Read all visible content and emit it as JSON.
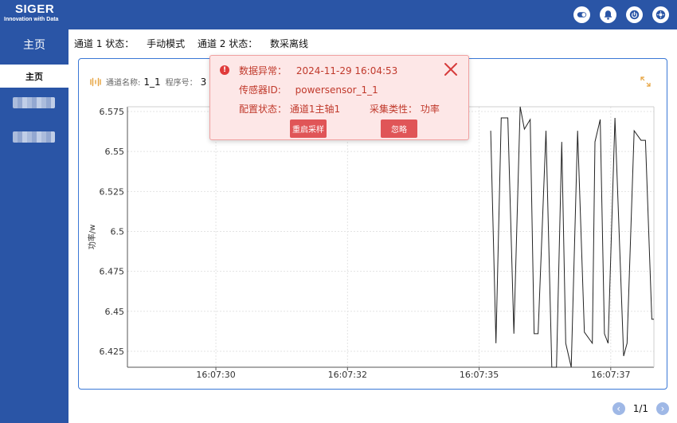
{
  "app": {
    "brand": "SIGER",
    "tagline": "Innovation with Data"
  },
  "header_icons": [
    "switch-icon",
    "bell-icon",
    "power-icon",
    "settings-icon"
  ],
  "sidebar": {
    "home_label": "主页",
    "active_label": "主页"
  },
  "status": {
    "ch1_label": "通道 1 状态：",
    "ch1_value": "手动模式",
    "ch2_label": "通道 2 状态：",
    "ch2_value": "数采离线"
  },
  "channel": {
    "name_label": "通道名称:",
    "name_value": "1_1",
    "program_label": "程序号：",
    "program_value": "3"
  },
  "alert": {
    "anomaly_label": "数据异常：",
    "anomaly_time": "2024-11-29 16:04:53",
    "sensor_label": "传感器ID:",
    "sensor_value": "powersensor_1_1",
    "config_label": "配置状态：",
    "config_value": "通道1主轴1",
    "type_label": "采集类性：",
    "type_value": "功率",
    "restart_label": "重启采样",
    "ignore_label": "忽略"
  },
  "pager": {
    "text": "1/1"
  },
  "colors": {
    "accent": "#2a55a6",
    "alert_text": "#c0392b",
    "alert_btn": "#e05557",
    "line": "#222222"
  },
  "chart_data": {
    "type": "line",
    "ylabel": "功率/w",
    "ylim": [
      6.415,
      6.578
    ],
    "xlim": [
      0,
      2000
    ],
    "yticks": [
      "6.575",
      "6.55",
      "6.525",
      "6.5",
      "6.475",
      "6.45",
      "6.425"
    ],
    "ytick_values": [
      6.575,
      6.55,
      6.525,
      6.5,
      6.475,
      6.45,
      6.425
    ],
    "xticks": [
      "16:07:30",
      "16:07:32",
      "16:07:35",
      "16:07:37"
    ],
    "xtick_values": [
      336,
      836,
      1336,
      1836
    ],
    "series": [
      {
        "x": [
          1380,
          1400,
          1420,
          1445,
          1468,
          1492,
          1508,
          1530,
          1545,
          1560,
          1590,
          1612,
          1630,
          1650,
          1665,
          1686,
          1710,
          1736,
          1766,
          1776,
          1796,
          1812,
          1826,
          1852,
          1885,
          1898,
          1925,
          1951,
          1968,
          1992,
          2000
        ],
        "y": [
          6.563,
          6.43,
          6.571,
          6.571,
          6.436,
          6.578,
          6.564,
          6.57,
          6.436,
          6.436,
          6.563,
          6.415,
          6.415,
          6.556,
          6.43,
          6.415,
          6.563,
          6.437,
          6.43,
          6.556,
          6.57,
          6.436,
          6.43,
          6.571,
          6.422,
          6.43,
          6.563,
          6.557,
          6.557,
          6.445,
          6.445
        ]
      }
    ]
  }
}
